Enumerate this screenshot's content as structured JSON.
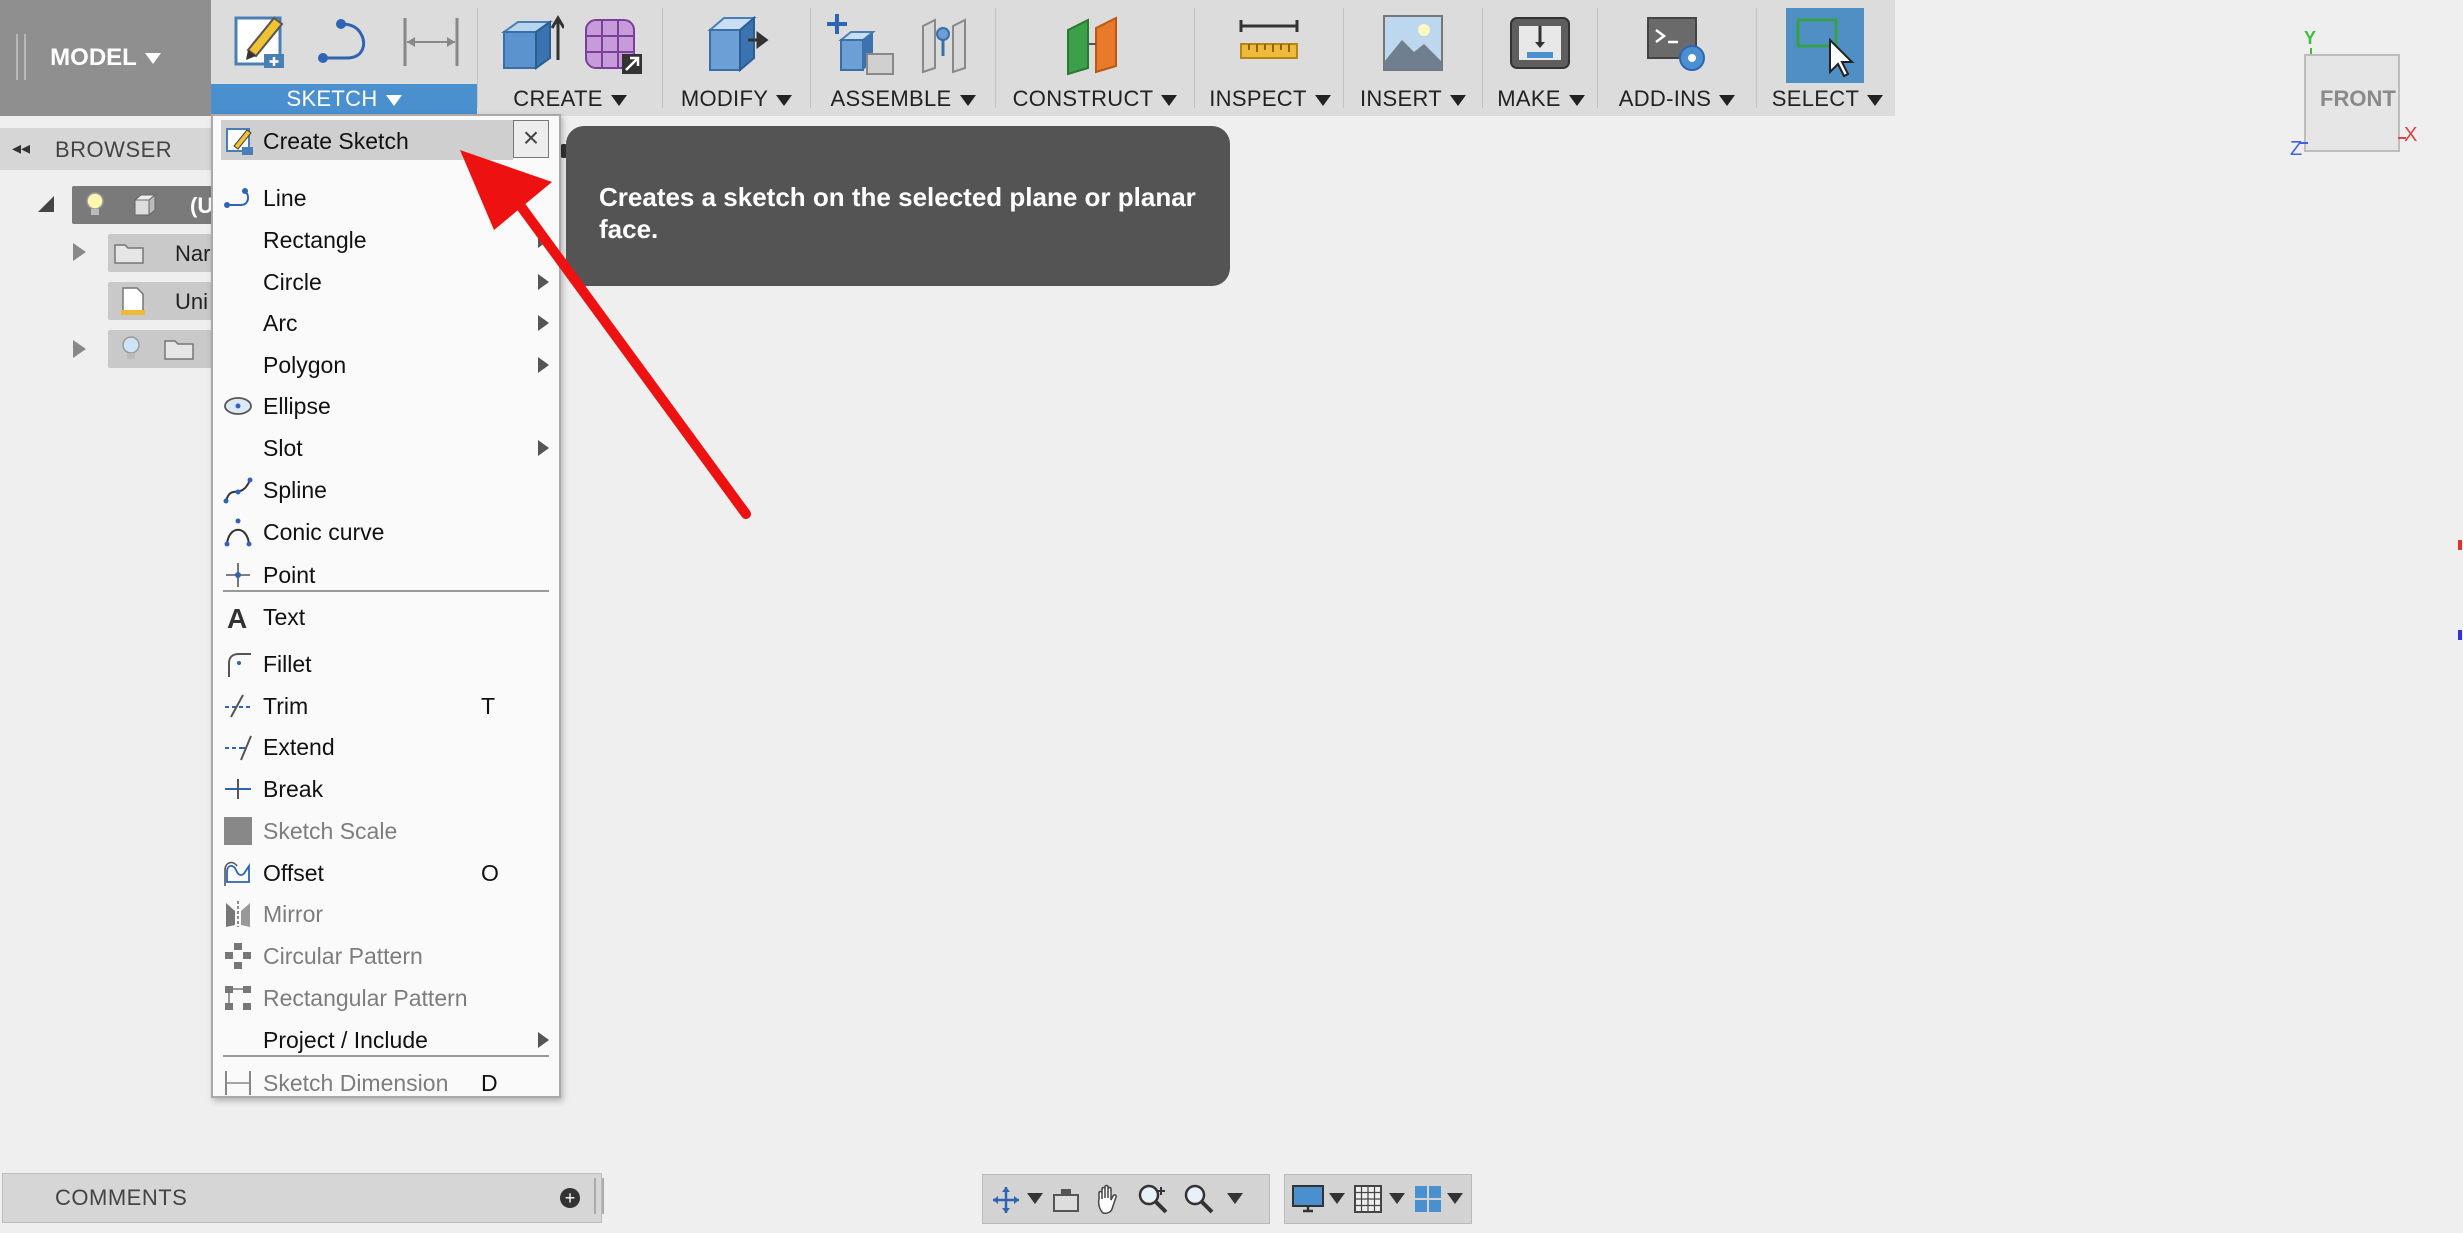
{
  "toolbar": {
    "model_label": "MODEL",
    "groups": {
      "sketch": "SKETCH",
      "create": "CREATE",
      "modify": "MODIFY",
      "assemble": "ASSEMBLE",
      "construct": "CONSTRUCT",
      "inspect": "INSPECT",
      "insert": "INSERT",
      "make": "MAKE",
      "addins": "ADD-INS",
      "select": "SELECT"
    }
  },
  "browser": {
    "title": "BROWSER",
    "rows": [
      {
        "label": "(U"
      },
      {
        "label": "Nar"
      },
      {
        "label": "Uni"
      },
      {
        "label": ""
      }
    ]
  },
  "menu": {
    "create_sketch": "Create Sketch",
    "items": [
      {
        "label": "Line",
        "icon": "line-icon"
      },
      {
        "label": "Rectangle",
        "submenu": true
      },
      {
        "label": "Circle",
        "submenu": true
      },
      {
        "label": "Arc",
        "submenu": true
      },
      {
        "label": "Polygon",
        "submenu": true
      },
      {
        "label": "Ellipse",
        "icon": "ellipse-icon"
      },
      {
        "label": "Slot",
        "submenu": true
      },
      {
        "label": "Spline",
        "icon": "spline-icon"
      },
      {
        "label": "Conic curve",
        "icon": "conic-curve-icon"
      },
      {
        "label": "Point",
        "icon": "point-icon"
      },
      {
        "label": "Text",
        "icon": "text-icon"
      },
      {
        "label": "Fillet",
        "icon": "fillet-icon"
      },
      {
        "label": "Trim",
        "icon": "trim-icon",
        "shortcut": "T"
      },
      {
        "label": "Extend",
        "icon": "extend-icon"
      },
      {
        "label": "Break",
        "icon": "break-icon"
      },
      {
        "label": "Sketch Scale",
        "icon": "sketch-scale-icon",
        "disabled": true
      },
      {
        "label": "Offset",
        "icon": "offset-icon",
        "shortcut": "O"
      },
      {
        "label": "Mirror",
        "icon": "mirror-icon",
        "disabled": true
      },
      {
        "label": "Circular Pattern",
        "icon": "circular-pattern-icon",
        "disabled": true
      },
      {
        "label": "Rectangular Pattern",
        "icon": "rectangular-pattern-icon",
        "disabled": true
      },
      {
        "label": "Project / Include",
        "submenu": true
      },
      {
        "label": "Sketch Dimension",
        "icon": "sketch-dimension-icon",
        "shortcut": "D",
        "disabled": true
      }
    ]
  },
  "tooltip": {
    "text": "Creates a sketch on the selected plane or planar face."
  },
  "viewcube": {
    "face_label": "FRONT",
    "axis_y": "Y",
    "axis_x": "X",
    "axis_z": "Z"
  },
  "comments": {
    "title": "COMMENTS"
  },
  "colors": {
    "sketch_tab": "#4a90cf",
    "tooltip_bg": "#545454",
    "arrow": "#ee1111",
    "select_active": "#4f8fc4"
  }
}
